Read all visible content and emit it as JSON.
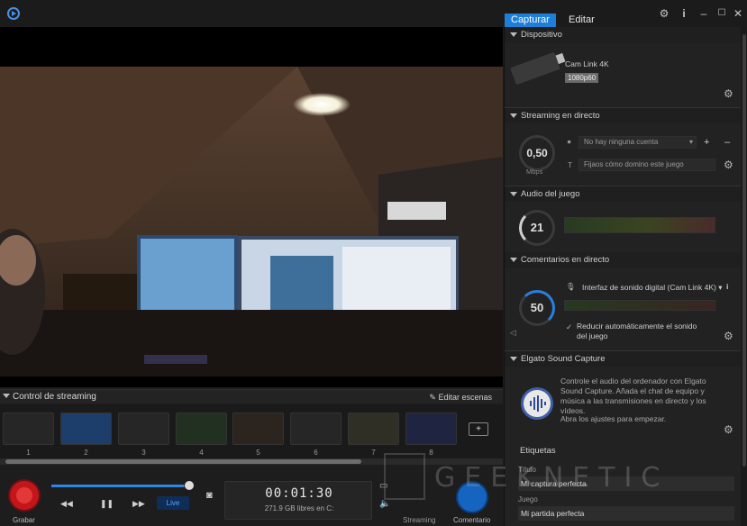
{
  "tabs": {
    "capture": "Capturar",
    "edit": "Editar"
  },
  "stream_control": {
    "title": "Control de streaming",
    "edit_scenes": "Editar escenas",
    "scene_numbers": [
      "1",
      "2",
      "3",
      "4",
      "5",
      "6",
      "7",
      "8"
    ]
  },
  "controls": {
    "record_label": "Grabar",
    "live": "Live",
    "timer": "00:01:30",
    "disk": "271.9 GB libres en C:",
    "streaming_label": "Streaming",
    "comment_label": "Comentario",
    "progress": 0.95
  },
  "panel": {
    "device": {
      "title": "Dispositivo",
      "name": "Cam Link 4K",
      "mode": "1080p60"
    },
    "streaming": {
      "title": "Streaming en directo",
      "bitrate": "0,50",
      "unit": "Mbps",
      "account": "No hay ninguna cuenta",
      "title_placeholder": "Fijaos cómo domino este juego"
    },
    "game_audio": {
      "title": "Audio del juego",
      "level": "21"
    },
    "commentary": {
      "title": "Comentarios en directo",
      "level": "50",
      "device": "Interfaz de sonido digital (Cam Link 4K)",
      "reduce": "Reducir automáticamente el sonido del juego"
    },
    "sound_capture": {
      "title": "Elgato Sound Capture",
      "desc": "Controle el audio del ordenador con Elgato Sound Capture. Añada el chat de equipo y música a las transmisiones en directo y los vídeos.",
      "hint": "Abra los ajustes para empezar."
    },
    "tags": {
      "title": "Etiquetas",
      "title_label": "Título",
      "title_value": "Mi captura perfecta",
      "game_label": "Juego",
      "game_value": "Mi partida perfecta"
    }
  },
  "watermark": "GEEKNETIC",
  "colors": {
    "accent": "#1e7fd8",
    "record": "#c2161b"
  }
}
